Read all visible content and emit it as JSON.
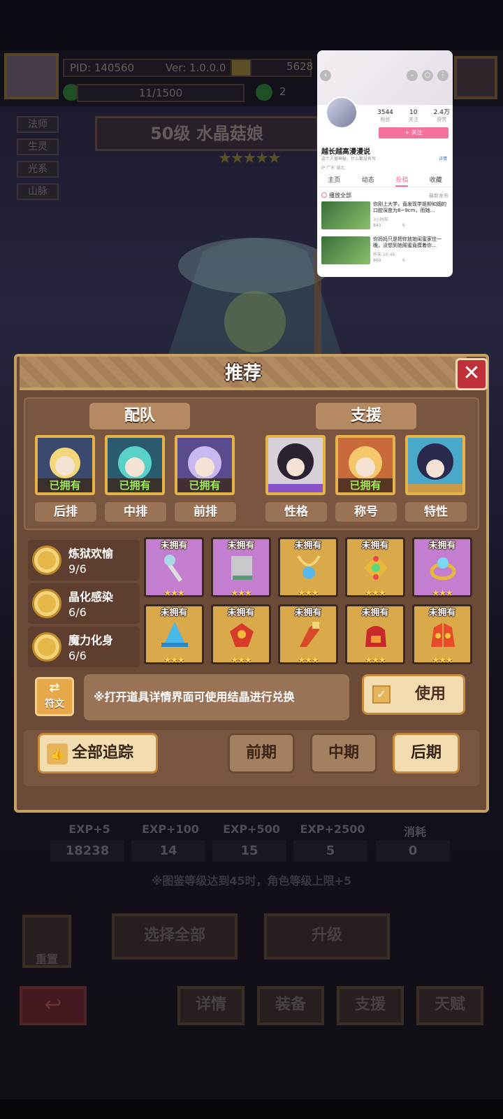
{
  "topbar": {
    "pid": "PID: 140560",
    "version": "Ver: 1.0.0.0",
    "gold": "5628",
    "clover_count": "11/1500",
    "clover_extra": "2"
  },
  "character": {
    "tags": [
      "法师",
      "生灵",
      "光系",
      "山脉"
    ],
    "name": "50级 水晶菇娘",
    "stars": "★★★★★"
  },
  "mini_window": {
    "stats": [
      {
        "value": "3544",
        "label": "粉丝"
      },
      {
        "value": "10",
        "label": "关注"
      },
      {
        "value": "2.4万",
        "label": "获赞"
      }
    ],
    "follow_label": "+ 关注",
    "user_name": "越长越高漫漫说",
    "bio": "这个人很神秘，什么都没有写",
    "bio_more": "详情",
    "bio_extra": "IP 广东   湖北",
    "tabs": [
      "主页",
      "动态",
      "投稿",
      "收藏"
    ],
    "play_all": "播放全部",
    "sort": "最新发布",
    "videos": [
      {
        "title": "你刚上大学，竟发现学姐柳如烟的口腔深度为8~9cm，而她…",
        "meta": "3小时前",
        "views": "843",
        "comments": "6"
      },
      {
        "title": "你妈妈只是把你放她闺蜜家住一晚，没想到她阁蜜竟摸着你…",
        "meta": "昨天 10:45",
        "views": "869",
        "comments": "6"
      }
    ]
  },
  "panel": {
    "title": "推荐",
    "close_label": "✕",
    "team_label": "配队",
    "support_label": "支援",
    "team": [
      {
        "position": "后排",
        "owned": "已拥有",
        "colors": [
          "#f3d77a",
          "#3a4a6e"
        ]
      },
      {
        "position": "中排",
        "owned": "已拥有",
        "colors": [
          "#5ad1c8",
          "#2a5a6e"
        ]
      },
      {
        "position": "前排",
        "owned": "已拥有",
        "colors": [
          "#c8b8f0",
          "#5a4a8e"
        ]
      }
    ],
    "support": [
      {
        "label": "性格",
        "owned": "",
        "colors": [
          "#2a2230",
          "#d8d0d8"
        ]
      },
      {
        "label": "称号",
        "owned": "已拥有",
        "colors": [
          "#f4c86a",
          "#c86a3a"
        ]
      },
      {
        "label": "特性",
        "owned": "",
        "colors": [
          "#2a2a4e",
          "#4aa8c8"
        ]
      }
    ],
    "skills": [
      {
        "name": "炼狱欢愉",
        "count": "9/6"
      },
      {
        "name": "晶化感染",
        "count": "6/6"
      },
      {
        "name": "魔力化身",
        "count": "6/6"
      }
    ],
    "items_not_owned_label": "未拥有",
    "item_stars": "★★★",
    "items": [
      {
        "icon": "wand-icon",
        "bg": "purple"
      },
      {
        "icon": "spellbook-icon",
        "bg": "purple"
      },
      {
        "icon": "pendant-icon",
        "bg": "gold"
      },
      {
        "icon": "gem-brooch-icon",
        "bg": "gold"
      },
      {
        "icon": "ring-icon",
        "bg": "purple"
      },
      {
        "icon": "crystal-hat-icon",
        "bg": "gold"
      },
      {
        "icon": "flame-armor-icon",
        "bg": "gold"
      },
      {
        "icon": "flame-boot-icon",
        "bg": "gold"
      },
      {
        "icon": "flame-cloak-icon",
        "bg": "gold"
      },
      {
        "icon": "flame-gloves-icon",
        "bg": "gold"
      }
    ],
    "rune_label": "符文",
    "hint": "※打开道具详情界面可使用结晶进行兑换",
    "use_label": "使用",
    "track_label": "全部追踪",
    "stages": [
      "前期",
      "中期",
      "后期"
    ]
  },
  "background": {
    "exp_labels": [
      "EXP+5",
      "EXP+100",
      "EXP+500",
      "EXP+2500",
      "消耗"
    ],
    "exp_values": [
      "18238",
      "14",
      "15",
      "5",
      "0"
    ],
    "level_hint": "※图鉴等级达到45时，角色等级上限+5",
    "reset_label": "重置",
    "select_all_label": "选择全部",
    "upgrade_label": "升级",
    "back_label": "↩",
    "bottom_tabs": [
      "详情",
      "装备",
      "支援",
      "天赋"
    ]
  },
  "colors": {
    "panel_bg": "#6b4a37",
    "panel_border": "#c6a062",
    "owned_green": "#9fe85a",
    "star_gold": "#ffd33a",
    "close_red": "#c0303a"
  }
}
